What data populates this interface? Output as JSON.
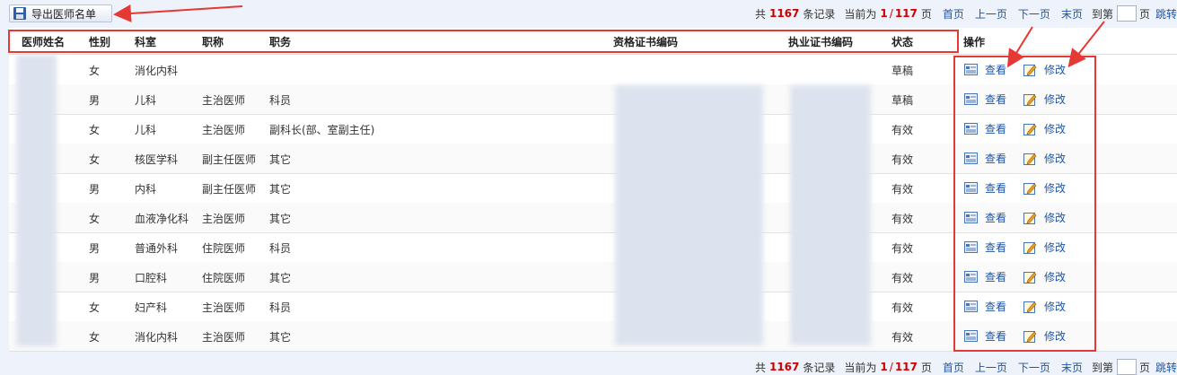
{
  "toolbar": {
    "export_label": "导出医师名单",
    "pager": {
      "prefix": "共",
      "total": "1167",
      "records": "条记录",
      "current_prefix": "当前为",
      "page_current": "1",
      "slash": "/",
      "page_total": "117",
      "page_unit": "页",
      "first": "首页",
      "prev": "上一页",
      "next": "下一页",
      "last": "末页",
      "goto_prefix": "到第",
      "goto_suffix": "页",
      "jump": "跳转"
    }
  },
  "table": {
    "headers": [
      "医师姓名",
      "性别",
      "科室",
      "职称",
      "职务",
      "资格证书编码",
      "执业证书编码",
      "状态",
      "操作"
    ],
    "rows": [
      {
        "gender": "女",
        "dept": "消化内科",
        "title": "",
        "position": "",
        "status": "草稿"
      },
      {
        "gender": "男",
        "dept": "儿科",
        "title": "主治医师",
        "position": "科员",
        "status": "草稿"
      },
      {
        "gender": "女",
        "dept": "儿科",
        "title": "主治医师",
        "position": "副科长(部、室副主任)",
        "status": "有效"
      },
      {
        "gender": "女",
        "dept": "核医学科",
        "title": "副主任医师",
        "position": "其它",
        "status": "有效"
      },
      {
        "gender": "男",
        "dept": "内科",
        "title": "副主任医师",
        "position": "其它",
        "status": "有效"
      },
      {
        "gender": "女",
        "dept": "血液净化科",
        "title": "主治医师",
        "position": "其它",
        "status": "有效"
      },
      {
        "gender": "男",
        "dept": "普通外科",
        "title": "住院医师",
        "position": "科员",
        "status": "有效"
      },
      {
        "gender": "男",
        "dept": "口腔科",
        "title": "住院医师",
        "position": "其它",
        "status": "有效"
      },
      {
        "gender": "女",
        "dept": "妇产科",
        "title": "主治医师",
        "position": "科员",
        "status": "有效"
      },
      {
        "gender": "女",
        "dept": "消化内科",
        "title": "主治医师",
        "position": "其它",
        "status": "有效"
      }
    ],
    "actions": {
      "view": "查看",
      "edit": "修改"
    }
  },
  "colors": {
    "accent_red": "#e53935",
    "link_blue": "#1f55a4",
    "count_red": "#cc0000"
  }
}
